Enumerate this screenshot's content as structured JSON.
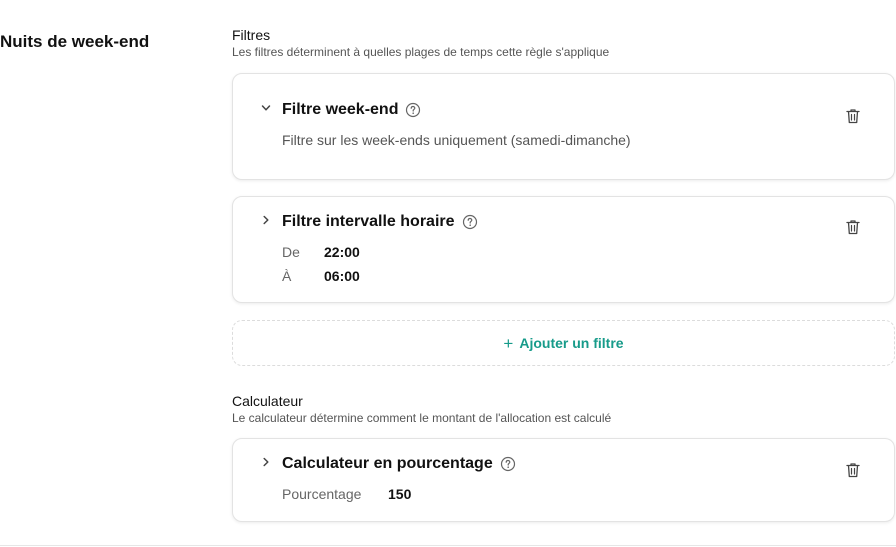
{
  "rule": {
    "title": "Nuits de week-end"
  },
  "filters": {
    "title": "Filtres",
    "description": "Les filtres déterminent à quelles plages de temps cette règle s'applique",
    "items": [
      {
        "title": "Filtre week-end",
        "expanded": true,
        "description": "Filtre sur les week-ends uniquement (samedi-dimanche)"
      },
      {
        "title": "Filtre intervalle horaire",
        "expanded": false,
        "from_label": "De",
        "from_value": "22:00",
        "to_label": "À",
        "to_value": "06:00"
      }
    ],
    "add_label": "Ajouter un filtre",
    "add_icon": "+"
  },
  "calculator": {
    "title": "Calculateur",
    "description": "Le calculateur détermine comment le montant de l'allocation est calculé",
    "item": {
      "title": "Calculateur en pourcentage",
      "expanded": false,
      "percentage_label": "Pourcentage",
      "percentage_value": "150"
    }
  },
  "colors": {
    "accent": "#179b8a",
    "text": "#111111",
    "muted": "#555555",
    "border": "#e3e3e3"
  }
}
